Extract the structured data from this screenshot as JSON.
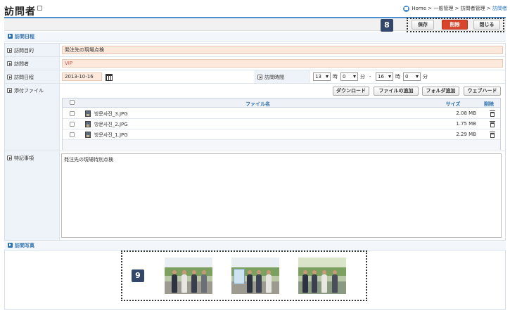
{
  "header": {
    "title": "訪問者",
    "breadcrumb": {
      "home": "Home",
      "sep": " > ",
      "level1": "一般管理",
      "level2": "訪問者管理",
      "current": "訪問者"
    }
  },
  "toolbar": {
    "save_label": "保存",
    "delete_label": "削除",
    "close_label": "閉じる",
    "marker": "8"
  },
  "sections": {
    "visit_schedule": "訪問日程",
    "visit_photos": "訪問写真"
  },
  "form": {
    "purpose_label": "訪問目的",
    "purpose_value": "発注先の現場点検",
    "visitor_label": "訪問者",
    "visitor_value": "VIP",
    "date_label": "訪問日程",
    "date_value": "2013-10-16",
    "time_label": "訪問時間",
    "time": {
      "start_hour": "13",
      "start_minute": "0",
      "end_hour": "16",
      "end_minute": "0",
      "hour_unit": "時",
      "minute_unit": "分",
      "separator": "-"
    },
    "attachments_label": "添付ファイル",
    "notes_label": "特記事項",
    "notes_value": "発注先の現場特別点検"
  },
  "attachments": {
    "buttons": {
      "download": "ダウンロード",
      "add_file": "ファイルの追加",
      "add_folder": "フォルダ追加",
      "webhard": "ウェブハード"
    },
    "columns": {
      "file_name": "ファイル名",
      "size": "サイズ",
      "delete": "削除"
    },
    "files": [
      {
        "name": "방문사진_3.JPG",
        "size": "2.08 MB"
      },
      {
        "name": "방문사진_2.JPG",
        "size": "1.75 MB"
      },
      {
        "name": "방문사진_1.JPG",
        "size": "2.29 MB"
      }
    ]
  },
  "photos": {
    "marker": "9",
    "count": 3
  },
  "colors": {
    "accent": "#2c6fae",
    "danger": "#d9452c",
    "input_bg": "#fde8dc",
    "marker_bg": "#33476b"
  }
}
